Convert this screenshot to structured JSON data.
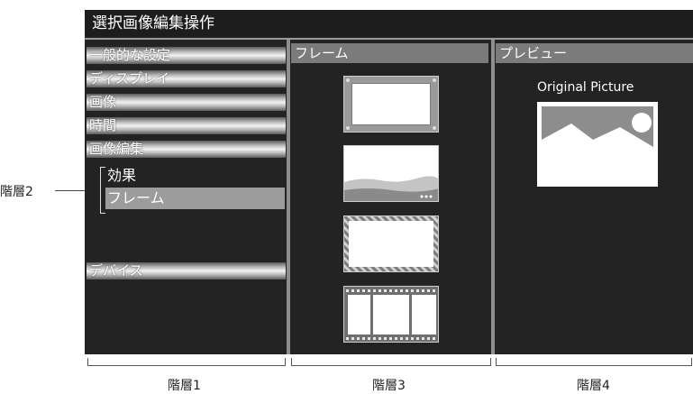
{
  "window": {
    "title": "選択画像編集操作"
  },
  "column1": {
    "menu_items": [
      {
        "label": "一般的な設定"
      },
      {
        "label": "ディスプレイ"
      },
      {
        "label": "画像"
      },
      {
        "label": "時間"
      },
      {
        "label": "画像編集"
      }
    ],
    "sub_items": [
      {
        "label": "効果",
        "selected": false
      },
      {
        "label": "フレーム",
        "selected": true
      }
    ],
    "device_item": {
      "label": "デバイス"
    }
  },
  "column2": {
    "header": "フレーム",
    "frames": [
      "plain-frame",
      "landscape-band-frame",
      "hatched-frame",
      "film-strip-frame"
    ]
  },
  "column3": {
    "header": "プレビュー",
    "preview_label": "Original Picture",
    "preview_icon": "image-placeholder-icon"
  },
  "annotations": {
    "layer1": "階層1",
    "layer2": "階層2",
    "layer3": "階層3",
    "layer4": "階層4"
  },
  "colors": {
    "screen_bg": "#232323",
    "header_bg": "#7b7b7b",
    "selected_bg": "#9c9c9c"
  }
}
